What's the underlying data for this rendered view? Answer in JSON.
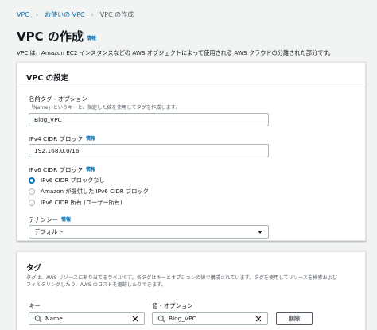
{
  "breadcrumb": {
    "items": [
      "VPC",
      "お使いの VPC",
      "VPC の作成"
    ]
  },
  "page": {
    "title": "VPC の作成",
    "info": "情報",
    "description": "VPC は、Amazon EC2 インスタンスなどの AWS オブジェクトによって使用される AWS クラウドの分離された部分です。"
  },
  "vpc_settings": {
    "title": "VPC の設定",
    "name_tag": {
      "label": "名前タグ - オプション",
      "description": "「Name」というキーと、指定した値を使用してタグを作成します。",
      "value": "Blog_VPC"
    },
    "ipv4": {
      "label": "IPv4 CIDR ブロック",
      "info": "情報",
      "value": "192.168.0.0/16"
    },
    "ipv6": {
      "label": "IPv6 CIDR ブロック",
      "info": "情報",
      "options": [
        "IPv6 CIDR ブロックなし",
        "Amazon が提供した IPv6 CIDR ブロック",
        "IPv6 CIDR 所有 (ユーザー所有)"
      ],
      "selected_index": 0
    },
    "tenancy": {
      "label": "テナンシー",
      "info": "情報",
      "selected": "デフォルト"
    }
  },
  "tags": {
    "title": "タグ",
    "description_line1": "タグは、AWS リソースに割り当てるラベルです。各タグはキーとオプションの値で構成されています。タグを使用してリソースを検索および",
    "description_line2": "フィルタリングしたり、AWS のコストを追跡したりできます。",
    "key_label": "キー",
    "value_label": "値 - オプション",
    "key_value": "Name",
    "value_value": "Blog_VPC",
    "remove_button": "削除"
  },
  "colors": {
    "link": "#0073bb",
    "background": "#f2f3f3",
    "panel": "#ffffff",
    "border": "#aab7b8"
  },
  "icons": {
    "breadcrumb_separator": "chevron-right-icon",
    "search": "search-icon",
    "clear": "close-icon",
    "dropdown": "caret-down-icon"
  }
}
